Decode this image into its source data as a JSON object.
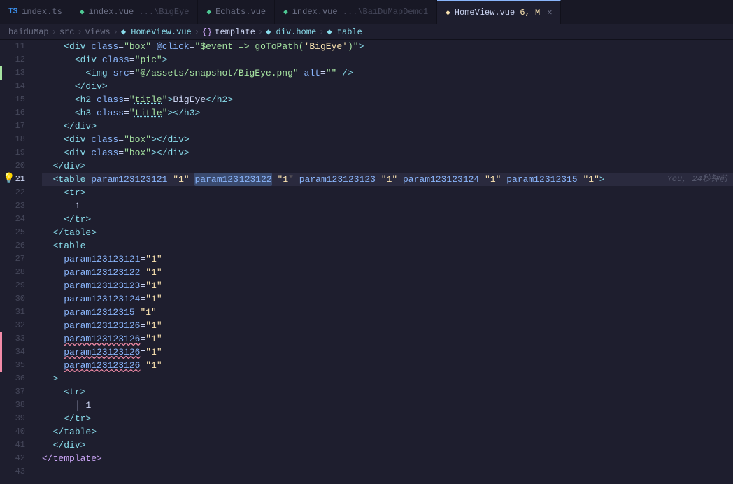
{
  "tabs": [
    {
      "id": "index-ts",
      "icon": "ts",
      "label": "index.ts",
      "active": false,
      "closable": false
    },
    {
      "id": "index-vue-bigeye",
      "icon": "vue",
      "label": "index.vue",
      "sublabel": "...\\BigEye",
      "active": false,
      "closable": false
    },
    {
      "id": "echats-vue",
      "icon": "vue",
      "label": "Echats.vue",
      "active": false,
      "closable": false
    },
    {
      "id": "index-vue-baidudemo",
      "icon": "vue",
      "label": "index.vue",
      "sublabel": "...\\BaiDuMapDemo1",
      "active": false,
      "closable": false
    },
    {
      "id": "homeview-vue",
      "icon": "vue",
      "label": "HomeView.vue 6, M",
      "active": true,
      "closable": true
    }
  ],
  "breadcrumb": {
    "parts": [
      "baiduMap",
      ">",
      "src",
      ">",
      "views",
      ">",
      "HomeView.vue",
      ">",
      "{}",
      "template",
      ">",
      "div.home",
      ">",
      "table"
    ]
  },
  "lines": [
    {
      "num": 11,
      "content": "    <div class=\"box\" @click=\"$event => goToPath('BigEye')\">",
      "indent": 4
    },
    {
      "num": 12,
      "content": "      <div class=\"pic\">",
      "indent": 6
    },
    {
      "num": 13,
      "content": "        <img src=\"@/assets/snapshot/BigEye.png\" alt=\"\" />",
      "indent": 8,
      "modified": true
    },
    {
      "num": 14,
      "content": "      </div>",
      "indent": 6
    },
    {
      "num": 15,
      "content": "      <h2 class=\"title\">BigEye</h2>",
      "indent": 6
    },
    {
      "num": 16,
      "content": "      <h3 class=\"title\"></h3>",
      "indent": 6
    },
    {
      "num": 17,
      "content": "    </div>",
      "indent": 4
    },
    {
      "num": 18,
      "content": "    <div class=\"box\"></div>",
      "indent": 4
    },
    {
      "num": 19,
      "content": "    <div class=\"box\"></div>",
      "indent": 4
    },
    {
      "num": 20,
      "content": "  </div>",
      "indent": 2
    },
    {
      "num": 21,
      "content": "  <table param123123121=\"1\" param123123122=\"1\" param123123123=\"1\" param123123124=\"1\" param12312315=\"1\">",
      "indent": 2,
      "active": true,
      "hint": "You, 24秒钟前"
    },
    {
      "num": 22,
      "content": "    <tr>",
      "indent": 4
    },
    {
      "num": 23,
      "content": "      1",
      "indent": 6
    },
    {
      "num": 24,
      "content": "    </tr>",
      "indent": 4
    },
    {
      "num": 25,
      "content": "  </table>",
      "indent": 2
    },
    {
      "num": 26,
      "content": "  <table",
      "indent": 2
    },
    {
      "num": 27,
      "content": "    param123123121=\"1\"",
      "indent": 4
    },
    {
      "num": 28,
      "content": "    param123123122=\"1\"",
      "indent": 4
    },
    {
      "num": 29,
      "content": "    param123123123=\"1\"",
      "indent": 4
    },
    {
      "num": 30,
      "content": "    param123123124=\"1\"",
      "indent": 4
    },
    {
      "num": 31,
      "content": "    param12312315=\"1\"",
      "indent": 4
    },
    {
      "num": 32,
      "content": "    param123123126=\"1\"",
      "indent": 4
    },
    {
      "num": 33,
      "content": "    param123123126=\"1\"",
      "indent": 4,
      "squiggly": true
    },
    {
      "num": 34,
      "content": "    param123123126=\"1\"",
      "indent": 4,
      "squiggly": true
    },
    {
      "num": 35,
      "content": "    param123123126=\"1\"",
      "indent": 4,
      "squiggly": true
    },
    {
      "num": 36,
      "content": "  >",
      "indent": 2
    },
    {
      "num": 37,
      "content": "    <tr>",
      "indent": 4
    },
    {
      "num": 38,
      "content": "      1",
      "indent": 6
    },
    {
      "num": 39,
      "content": "    </tr>",
      "indent": 4
    },
    {
      "num": 40,
      "content": "  </table>",
      "indent": 2
    },
    {
      "num": 41,
      "content": "  </div>",
      "indent": 2
    },
    {
      "num": 42,
      "content": "</template>",
      "indent": 0
    },
    {
      "num": 43,
      "content": "",
      "indent": 0
    }
  ]
}
